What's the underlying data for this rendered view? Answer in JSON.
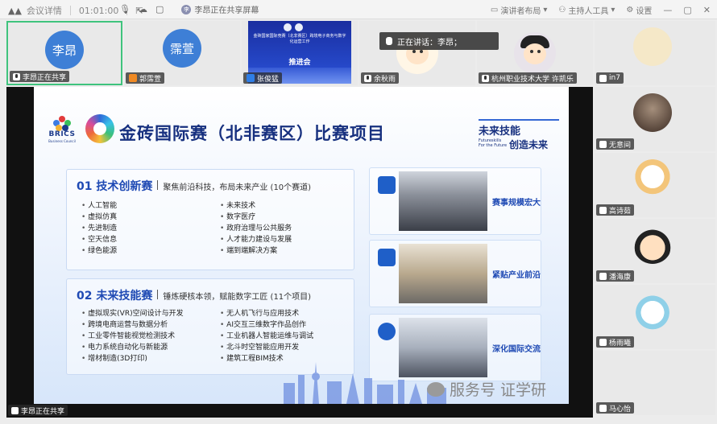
{
  "topbar": {
    "meeting_details": "会议详情",
    "timer": "01:01:00",
    "sharing_status": "李昂正在共享屏幕",
    "layout": "演讲者布局",
    "host_tools": "主持人工具",
    "settings": "设置"
  },
  "tiles": [
    {
      "avatar_text": "李昂",
      "label": "李昂正在共享"
    },
    {
      "avatar_text": "霈萱",
      "label": "郭霈萱"
    },
    {
      "label": "张俊猛",
      "poster_title": "金砖国家国际竞赛（北非赛区）跨境电子商务与数字化运营工作",
      "poster_subtitle": "推进会"
    },
    {
      "label": "余秋雨"
    },
    {
      "label": "杭州职业技术大学  许凯乐"
    }
  ],
  "speaking_tip": "正在讲话：李昂；",
  "sidebar": [
    {
      "label": "in7"
    },
    {
      "label": "无意间"
    },
    {
      "label": "高诗茹"
    },
    {
      "label": "潘海康"
    },
    {
      "label": "杨雨曦"
    },
    {
      "label": "马心怡"
    }
  ],
  "slide": {
    "brics": "BRICS",
    "brics_sub": "Business Council",
    "title": "金砖国际赛（北非赛区）比赛项目",
    "future_cn": "未来技能",
    "future_en": "Futureskills For the Future",
    "future_cn2": "创造未来",
    "card1": {
      "name": "01 技术创新赛",
      "desc": "聚焦前沿科技，布局未来产业 (10个赛道)",
      "left": [
        "人工智能",
        "虚拟仿真",
        "先进制造",
        "空天信息",
        "绿色能源"
      ],
      "right": [
        "未来技术",
        "数字医疗",
        "政府治理与公共服务",
        "人才能力建设与发展",
        "端到端解决方案"
      ]
    },
    "card2": {
      "name": "02 未来技能赛",
      "desc": "锤炼硬核本领，赋能数字工匠 (11个项目)",
      "left": [
        "虚拟现实(VR)空间设计与开发",
        "跨境电商运营与数据分析",
        "工业零件智能视觉检测技术",
        "电力系统自动化与新能源",
        "增材制造(3D打印)"
      ],
      "right": [
        "无人机飞行与应用技术",
        "AI交互三维数字作品创作",
        "工业机器人智能运维与调试",
        "北斗时空智能应用开发",
        "建筑工程BIM技术"
      ]
    },
    "photos": [
      "赛事规模宏大",
      "紧贴产业前沿",
      "深化国际交流"
    ]
  },
  "watermark": "服务号  证学研",
  "share_label": "李昂正在共享"
}
